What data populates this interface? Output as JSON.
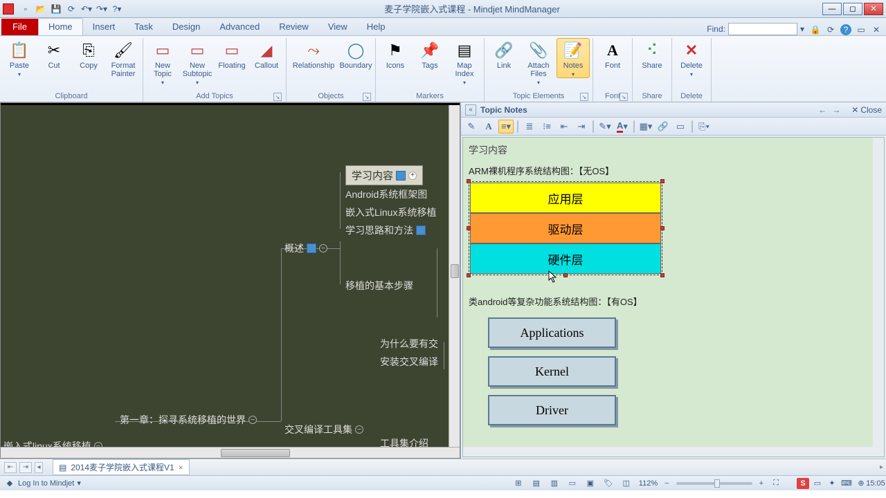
{
  "app": {
    "title": "麦子学院嵌入式课程 - Mindjet MindManager"
  },
  "tabs": {
    "file": "File",
    "items": [
      "Home",
      "Insert",
      "Task",
      "Design",
      "Advanced",
      "Review",
      "View",
      "Help"
    ],
    "active": 0,
    "find_label": "Find:"
  },
  "ribbon": {
    "clipboard": {
      "label": "Clipboard",
      "paste": "Paste",
      "cut": "Cut",
      "copy": "Copy",
      "format_painter": "Format\nPainter"
    },
    "addtopics": {
      "label": "Add Topics",
      "new_topic": "New\nTopic",
      "new_subtopic": "New\nSubtopic",
      "floating": "Floating",
      "callout": "Callout"
    },
    "objects": {
      "label": "Objects",
      "relationship": "Relationship",
      "boundary": "Boundary"
    },
    "markers": {
      "label": "Markers",
      "icons": "Icons",
      "tags": "Tags",
      "mapindex": "Map\nIndex"
    },
    "topicelements": {
      "label": "Topic Elements",
      "link": "Link",
      "attach": "Attach\nFiles",
      "notes": "Notes"
    },
    "font": {
      "label": "Font",
      "font": "Font"
    },
    "share": {
      "label": "Share",
      "share": "Share"
    },
    "delete": {
      "label": "Delete",
      "delete": "Delete"
    }
  },
  "canvas": {
    "root": "嵌入式linux系统移植",
    "nodes": {
      "study": "学习内容",
      "android_fw": "Android系统框架图",
      "linux_port": "嵌入式Linux系统移植",
      "method": "学习思路和方法",
      "overview": "概述",
      "steps": "移植的基本步骤",
      "why": "为什么要有交",
      "install": "安装交叉编译",
      "ch1": "第一章：探寻系统移植的世界",
      "toolchain": "交叉编译工具集",
      "toolintro": "工具集介绍"
    }
  },
  "notes": {
    "panel_title": "Topic Notes",
    "close": "Close",
    "heading": "学习内容",
    "caption1": "ARM裸机程序系统结构图：【无OS】",
    "layers": [
      "应用层",
      "驱动层",
      "硬件层"
    ],
    "caption2": "类android等复杂功能系统结构图：【有OS】",
    "boxes": [
      "Applications",
      "Kernel",
      "Driver"
    ]
  },
  "doc": {
    "tab": "2014麦子学院嵌入式课程V1"
  },
  "status": {
    "login": "Log In to Mindjet",
    "zoom": "112%",
    "time": "15:05"
  }
}
